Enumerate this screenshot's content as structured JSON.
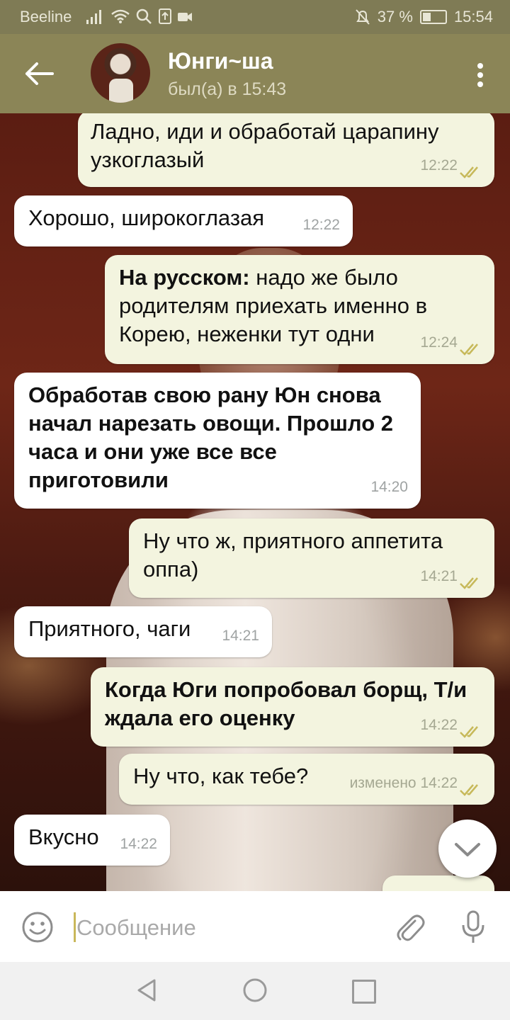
{
  "status_bar": {
    "carrier": "Beeline",
    "battery": "37 %",
    "time": "15:54"
  },
  "header": {
    "contact_name": "Юнги~ша",
    "last_seen": "был(а) в 15:43"
  },
  "messages": [
    {
      "dir": "out",
      "text": "Ладно, иди и обработай царапину узкоглазый",
      "time": "12:22"
    },
    {
      "dir": "in",
      "text": "Хорошо, широкоглазая",
      "time": "12:22"
    },
    {
      "dir": "out",
      "bold_prefix": "На русском:",
      "text": " надо же было родителям приехать именно в Корею, неженки тут одни",
      "time": "12:24"
    },
    {
      "dir": "in",
      "bold_text": "Обработав свою рану Юн снова начал нарезать овощи. Прошло 2 часа и они уже все все приготовили",
      "time": "14:20"
    },
    {
      "dir": "out",
      "text": "Ну что ж, приятного аппетита оппа)",
      "time": "14:21"
    },
    {
      "dir": "in",
      "text": "Приятного, чаги",
      "time": "14:21"
    },
    {
      "dir": "out",
      "bold_text": "Когда Юги попробовал борщ, Т/и ждала его оценку",
      "time": "14:22"
    },
    {
      "dir": "out",
      "text": "Ну что, как тебе?",
      "time": "изменено 14:22"
    },
    {
      "dir": "in",
      "text": "Вкусно",
      "time": "14:22"
    }
  ],
  "input": {
    "placeholder": "Сообщение"
  },
  "colors": {
    "header": "#8b8557",
    "status_bar": "#7f7b55",
    "outgoing_bubble": "#f3f4df",
    "incoming_bubble": "#ffffff",
    "tick": "#c7b95a"
  }
}
